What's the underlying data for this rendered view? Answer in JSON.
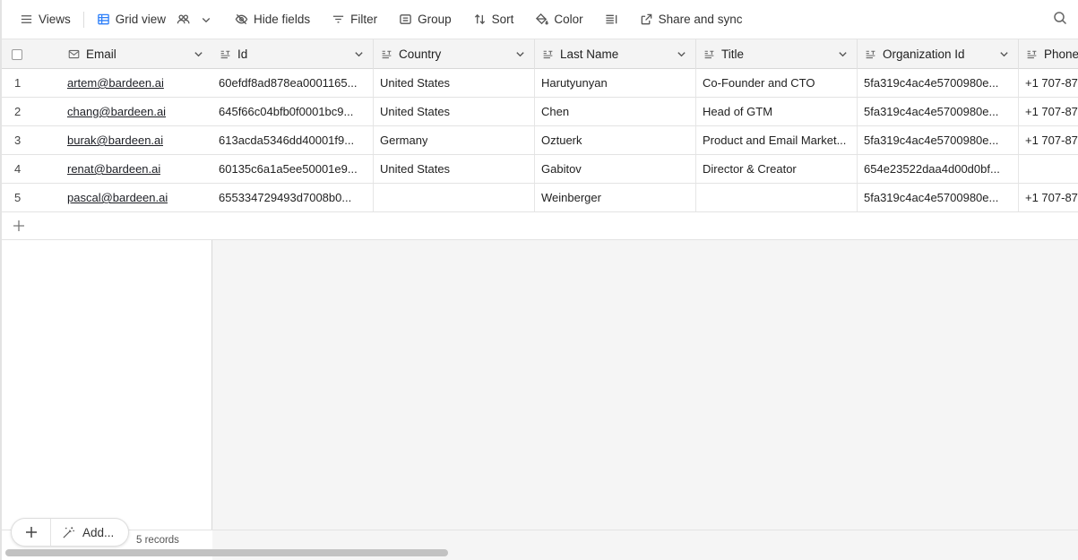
{
  "toolbar": {
    "views_label": "Views",
    "grid_view_label": "Grid view",
    "hide_fields_label": "Hide fields",
    "filter_label": "Filter",
    "group_label": "Group",
    "sort_label": "Sort",
    "color_label": "Color",
    "share_label": "Share and sync"
  },
  "columns": {
    "email": "Email",
    "id": "Id",
    "country": "Country",
    "last_name": "Last Name",
    "title": "Title",
    "organization_id": "Organization Id",
    "phone": "Phone"
  },
  "rows": [
    {
      "num": "1",
      "email": "artem@bardeen.ai",
      "id": "60efdf8ad878ea0001165...",
      "country": "United States",
      "last_name": "Harutyunyan",
      "title": "Co-Founder and CTO",
      "organization_id": "5fa319c4ac4e5700980e...",
      "phone": "+1 707-87"
    },
    {
      "num": "2",
      "email": "chang@bardeen.ai",
      "id": "645f66c04bfb0f0001bc9...",
      "country": "United States",
      "last_name": "Chen",
      "title": "Head of GTM",
      "organization_id": "5fa319c4ac4e5700980e...",
      "phone": "+1 707-87"
    },
    {
      "num": "3",
      "email": "burak@bardeen.ai",
      "id": "613acda5346dd40001f9...",
      "country": "Germany",
      "last_name": "Oztuerk",
      "title": "Product and Email Market...",
      "organization_id": "5fa319c4ac4e5700980e...",
      "phone": "+1 707-87"
    },
    {
      "num": "4",
      "email": "renat@bardeen.ai",
      "id": "60135c6a1a5ee50001e9...",
      "country": "United States",
      "last_name": "Gabitov",
      "title": "Director & Creator",
      "organization_id": "654e23522daa4d00d0bf...",
      "phone": ""
    },
    {
      "num": "5",
      "email": "pascal@bardeen.ai",
      "id": "655334729493d7008b0...",
      "country": "",
      "last_name": "Weinberger",
      "title": "",
      "organization_id": "5fa319c4ac4e5700980e...",
      "phone": "+1 707-87"
    }
  ],
  "footer": {
    "add_label": "Add...",
    "records_count": "5 records"
  }
}
